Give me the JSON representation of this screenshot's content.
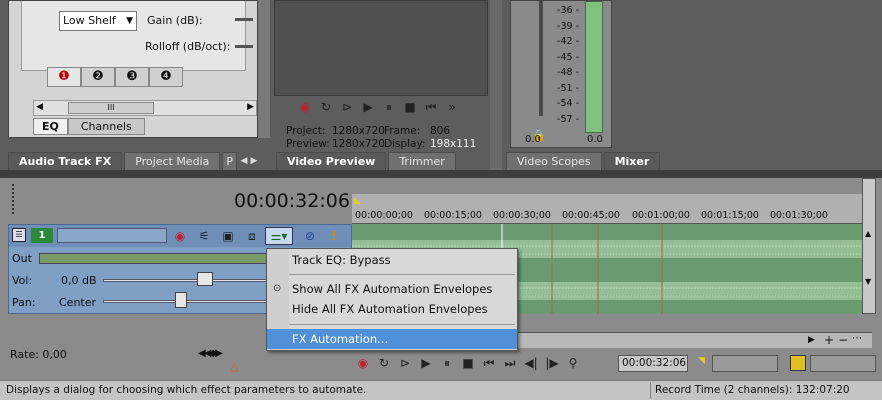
{
  "eq": {
    "filter_type": "Low Shelf",
    "gain_label": "Gain (dB):",
    "rolloff_label": "Rolloff (dB/oct):",
    "bands": [
      "❶",
      "❷",
      "❸",
      "❹"
    ],
    "scroll_grip": "III",
    "tabs": [
      "EQ",
      "Channels"
    ]
  },
  "top_tabs": {
    "audio_fx": "Audio Track FX",
    "project_media": "Project Media",
    "more": "P",
    "video_preview": "Video Preview",
    "trimmer": "Trimmer",
    "video_scopes": "Video Scopes",
    "mixer": "Mixer"
  },
  "preview": {
    "project_label": "Project:",
    "project_value": "1280x720",
    "frame_label": "Frame:",
    "frame_value": "806",
    "preview_label": "Preview:",
    "preview_value": "1280x720",
    "display_label": "Display:",
    "display_value": "198x111"
  },
  "mixer": {
    "scale": [
      "-36 -",
      "-39 -",
      "-42 -",
      "-45 -",
      "-48 -",
      "-51 -",
      "-54 -",
      "-57 -"
    ],
    "left_value": "0.0",
    "right_value": "0.0"
  },
  "timeline": {
    "timecode": "00:00:32:06",
    "ruler": [
      "00:00:00;00",
      "00:00:15;00",
      "00:00:30;00",
      "00:00:45;00",
      "00:01:00;00",
      "00:01:15;00",
      "00:01:30;00"
    ],
    "cursor_time": "00:00:32:06",
    "rate": "Rate: 0,00"
  },
  "track": {
    "number": "1",
    "out_label": "Out",
    "vol_label": "Vol:",
    "vol_value": "0,0 dB",
    "pan_label": "Pan:",
    "pan_value": "Center"
  },
  "menu": {
    "items": [
      "Track EQ: Bypass",
      "Show All FX Automation Envelopes",
      "Hide All FX Automation Envelopes",
      "FX Automation..."
    ],
    "selected_index": 3,
    "radio_checked_index": 1
  },
  "status": {
    "message": "Displays a dialog for choosing which effect parameters to automate.",
    "record_time": "Record Time (2 channels): 132:07:20"
  },
  "colors": {
    "accent": "#4f90d8",
    "track_header": "#7f9fc5",
    "waveform_bg": "#6a9a70",
    "waveform": "#c8e6c8"
  }
}
